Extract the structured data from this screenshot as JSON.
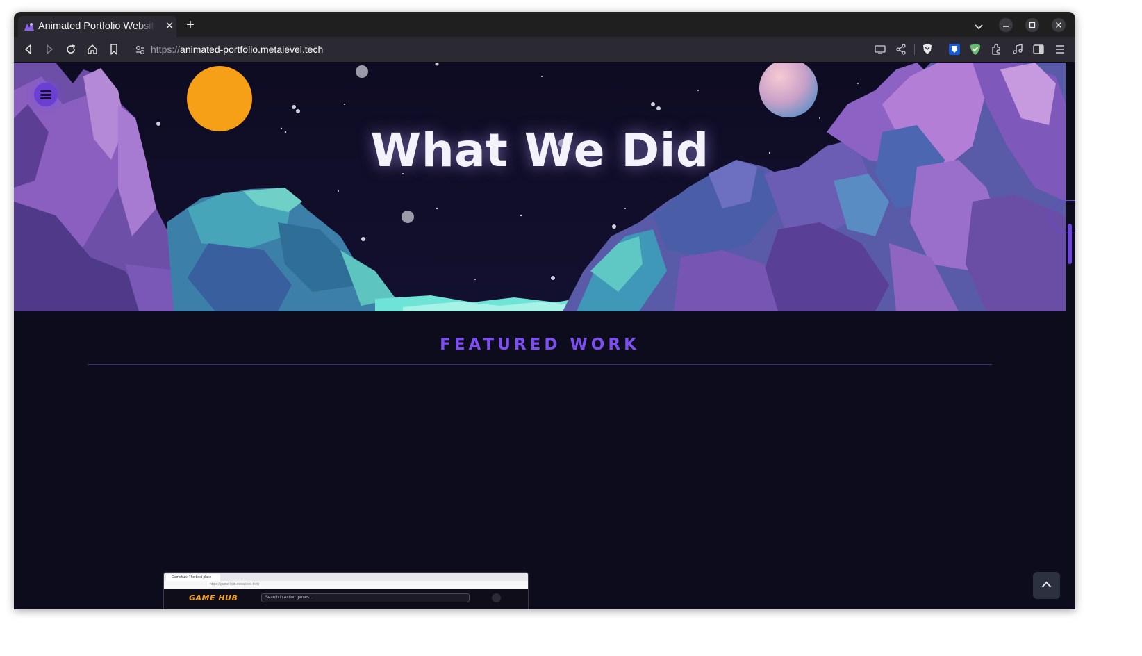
{
  "browser": {
    "tab": {
      "title": "Animated Portfolio Website",
      "favicon": "portfolio-favicon-icon"
    },
    "new_tab_icon": "plus-icon",
    "url": {
      "scheme": "https://",
      "host": "animated-portfolio.metalevel.tech"
    },
    "window_buttons": [
      "minimize-icon",
      "maximize-icon",
      "close-icon"
    ],
    "toolbar_icons": [
      "back-icon",
      "forward-icon",
      "reload-icon",
      "home-icon",
      "bookmark-icon",
      "site-info-icon",
      "cast-icon",
      "share-icon",
      "brave-shield-icon",
      "bitwarden-icon",
      "adguard-icon",
      "extensions-icon",
      "media-icon",
      "sidebar-icon",
      "app-menu-icon"
    ]
  },
  "page": {
    "hero_title": "What We Did",
    "section_title": "FEATURED WORK",
    "menu_icon": "hamburger-menu-icon",
    "scroll_top_icon": "chevron-up-icon",
    "preview": {
      "tab_title": "Gamehub: The best place",
      "url": "https://game-hub.metalevel.tech",
      "logo": "GAME HUB",
      "search_placeholder": "Search in Action games..."
    },
    "colors": {
      "background": "#0d0c1d",
      "accent": "#7d4ff0",
      "sun": "#f6a018",
      "title": "#f4f2fa"
    }
  }
}
